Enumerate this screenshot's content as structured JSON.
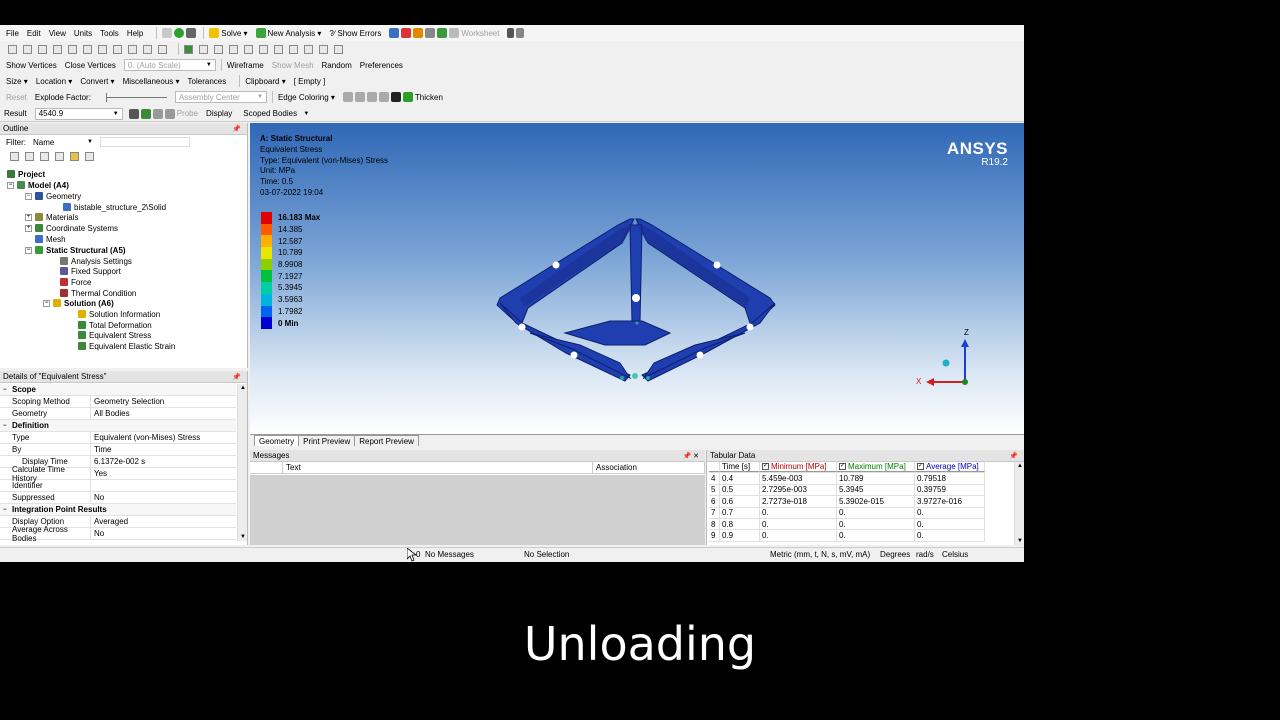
{
  "menubar": [
    "File",
    "Edit",
    "View",
    "Units",
    "Tools",
    "Help"
  ],
  "menubar_actions": {
    "solve": "Solve",
    "new_analysis": "New Analysis",
    "show_errors": "?∕ Show Errors",
    "worksheet": "Worksheet"
  },
  "toolbar3": {
    "show_vertices": "Show Vertices",
    "close_vertices": "Close Vertices",
    "auto_scale": "0. (Auto Scale)",
    "wireframe": "Wireframe",
    "show_mesh": "Show Mesh",
    "random": "Random",
    "preferences": "Preferences"
  },
  "toolbar4": {
    "size": "Size",
    "location": "Location",
    "convert": "Convert",
    "miscellaneous": "Miscellaneous",
    "tolerances": "Tolerances",
    "clipboard": "Clipboard",
    "clipboard_value": "[ Empty ]"
  },
  "toolbar5": {
    "reset": "Reset",
    "explode_factor": "Explode Factor:",
    "assembly_center": "Assembly Center",
    "edge_coloring": "Edge Coloring",
    "thicken": "Thicken"
  },
  "result_bar": {
    "result_label": "Result",
    "result_value": "4540.9",
    "probe": "Probe",
    "display": "Display",
    "scoped_bodies": "Scoped Bodies"
  },
  "outline": {
    "title": "Outline",
    "filter_label": "Filter:",
    "filter_value": "Name",
    "tree": {
      "project": "Project",
      "model": "Model (A4)",
      "geometry": "Geometry",
      "solid": "bistable_structure_2\\Solid",
      "materials": "Materials",
      "coord": "Coordinate Systems",
      "mesh": "Mesh",
      "static": "Static Structural (A5)",
      "analysis": "Analysis Settings",
      "fixed": "Fixed Support",
      "force": "Force",
      "thermal": "Thermal Condition",
      "solution": "Solution (A6)",
      "sol_info": "Solution Information",
      "total_def": "Total Deformation",
      "eq_stress": "Equivalent Stress",
      "eq_strain": "Equivalent Elastic Strain"
    }
  },
  "details": {
    "title": "Details of \"Equivalent Stress\"",
    "rows": [
      {
        "k": "Scope",
        "section": true
      },
      {
        "k": "Scoping Method",
        "v": "Geometry Selection"
      },
      {
        "k": "Geometry",
        "v": "All Bodies"
      },
      {
        "k": "Definition",
        "section": true
      },
      {
        "k": "Type",
        "v": "Equivalent (von-Mises) Stress"
      },
      {
        "k": "By",
        "v": "Time"
      },
      {
        "k": "Display Time",
        "v": "6.1372e-002 s",
        "indent": true
      },
      {
        "k": "Calculate Time History",
        "v": "Yes"
      },
      {
        "k": "Identifier",
        "v": ""
      },
      {
        "k": "Suppressed",
        "v": "No"
      },
      {
        "k": "Integration Point Results",
        "section": true
      },
      {
        "k": "Display Option",
        "v": "Averaged"
      },
      {
        "k": "Average Across Bodies",
        "v": "No"
      }
    ]
  },
  "viewport": {
    "info_title": "A: Static Structural",
    "info_result": "Equivalent Stress",
    "info_type": "Type: Equivalent (von-Mises) Stress",
    "info_unit": "Unit: MPa",
    "info_time": "Time: 0.5",
    "info_date": "03-07-2022 19:04",
    "logo_name": "ANSYS",
    "logo_version": "R19.2",
    "legend": [
      {
        "label": "16.183 Max",
        "color": "#e00000",
        "bold": true
      },
      {
        "label": "14.385",
        "color": "#ff5a00"
      },
      {
        "label": "12.587",
        "color": "#ffb000"
      },
      {
        "label": "10.789",
        "color": "#e6e600"
      },
      {
        "label": "8.9908",
        "color": "#8cd000"
      },
      {
        "label": "7.1927",
        "color": "#00c040"
      },
      {
        "label": "5.3945",
        "color": "#00d0a0"
      },
      {
        "label": "3.5963",
        "color": "#00b4e0"
      },
      {
        "label": "1.7982",
        "color": "#0064f0"
      },
      {
        "label": "0 Min",
        "color": "#0000d0",
        "bold": true
      }
    ],
    "triad_z": "Z",
    "triad_x": "X"
  },
  "view_tabs": [
    "Geometry",
    "Print Preview",
    "Report Preview"
  ],
  "messages": {
    "title": "Messages",
    "col_text": "Text",
    "col_assoc": "Association"
  },
  "tabular": {
    "title": "Tabular Data",
    "headers": [
      "Time [s]",
      "Minimum [MPa]",
      "Maximum [MPa]",
      "Average [MPa]"
    ],
    "header_colors": [
      "#000000",
      "#c00000",
      "#008000",
      "#0000c0"
    ],
    "rows": [
      {
        "n": "4",
        "t": "0.4",
        "min": "5.459e-003",
        "max": "10.789",
        "avg": "0.79518"
      },
      {
        "n": "5",
        "t": "0.5",
        "min": "2.7295e-003",
        "max": "5.3945",
        "avg": "0.39759"
      },
      {
        "n": "6",
        "t": "0.6",
        "min": "2.7273e-018",
        "max": "5.3902e-015",
        "avg": "3.9727e-016"
      },
      {
        "n": "7",
        "t": "0.7",
        "min": "0.",
        "max": "0.",
        "avg": "0."
      },
      {
        "n": "8",
        "t": "0.8",
        "min": "0.",
        "max": "0.",
        "avg": "0."
      },
      {
        "n": "9",
        "t": "0.9",
        "min": "0.",
        "max": "0.",
        "avg": "0."
      }
    ]
  },
  "statusbar": {
    "messages_count": "0",
    "messages": "No Messages",
    "selection": "No Selection",
    "units": "Metric (mm, t, N, s, mV, mA)",
    "angle": "Degrees",
    "rot": "rad/s",
    "temp": "Celsius"
  },
  "caption": "Unloading",
  "colors": {
    "viewport_top": "#2f68b7",
    "model_blue": "#1f3fb0",
    "panel_bg": "#f0f0f0"
  }
}
